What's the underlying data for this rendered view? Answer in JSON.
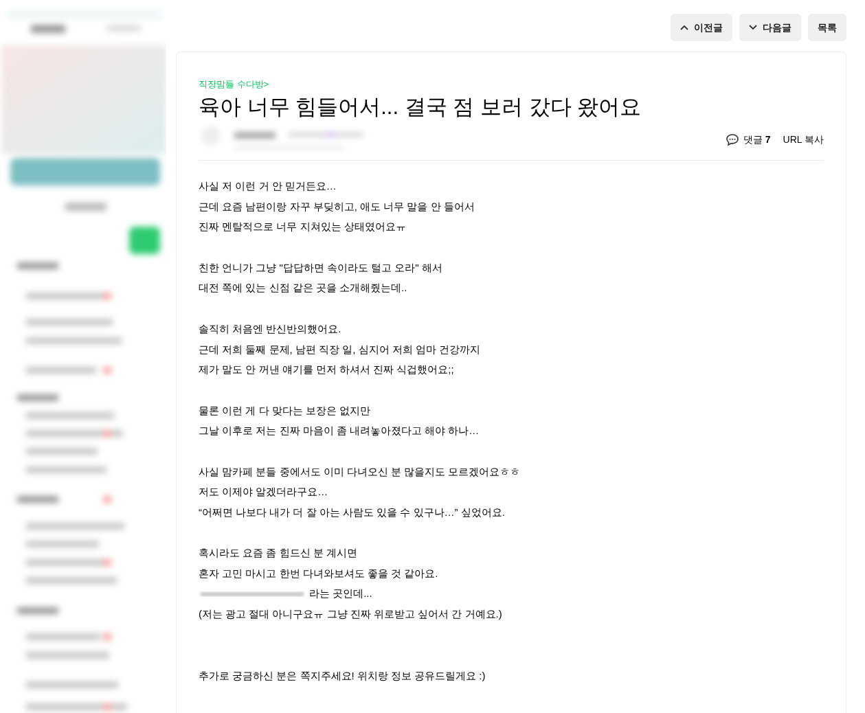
{
  "nav_buttons": [
    {
      "kind": "up",
      "label": "이전글"
    },
    {
      "kind": "down",
      "label": "다음글"
    },
    {
      "kind": "plain",
      "label": "목록"
    }
  ],
  "post": {
    "category": "직장맘들 수다방>",
    "title": "육아 너무 힘들어서... 결국 점 보러 갔다 왔어요",
    "comments_label": "댓글",
    "comments_count": "7",
    "url_copy": "URL 복사",
    "body": [
      {
        "kind": "line",
        "text": "사실 저 이런 거 안 믿거든요…"
      },
      {
        "kind": "line",
        "text": "근데 요즘 남편이랑 자꾸 부딪히고, 애도 너무 말을 안 들어서"
      },
      {
        "kind": "line",
        "text": "진짜 멘탈적으로 너무 지쳐있는 상태였어요ㅠ"
      },
      {
        "kind": "blank"
      },
      {
        "kind": "line",
        "text": "친한 언니가 그냥 \"답답하면 속이라도 털고 오라\" 해서"
      },
      {
        "kind": "line",
        "text": "대전 쪽에 있는 신점 같은 곳을 소개해줬는데.."
      },
      {
        "kind": "blank"
      },
      {
        "kind": "line",
        "text": "솔직히 처음엔 반신반의했어요."
      },
      {
        "kind": "line",
        "text": "근데 저희 둘째 문제, 남편 직장 일, 심지어 저희 엄마 건강까지"
      },
      {
        "kind": "line",
        "text": "제가 말도 안 꺼낸 얘기를 먼저 하셔서 진짜 식겁했어요;;"
      },
      {
        "kind": "blank"
      },
      {
        "kind": "line",
        "text": "물론 이런 게 다 맞다는 보장은 없지만"
      },
      {
        "kind": "line",
        "text": "그날 이후로 저는 진짜 마음이 좀 내려놓아졌다고 해야 하나…"
      },
      {
        "kind": "blank"
      },
      {
        "kind": "line",
        "text": "사실 맘카페 분들 중에서도 이미 다녀오신 분 많을지도 모르겠어요ㅎㅎ"
      },
      {
        "kind": "line",
        "text": "저도 이제야 알겠더라구요…"
      },
      {
        "kind": "line",
        "text": "“어쩌면 나보다 내가 더 잘 아는 사람도 있을 수 있구나…” 싶었어요."
      },
      {
        "kind": "blank"
      },
      {
        "kind": "line",
        "text": "혹시라도 요즘 좀 힘드신 분 계시면"
      },
      {
        "kind": "line",
        "text": "혼자 고민 마시고 한번 다녀와보셔도 좋을 것 같아요."
      },
      {
        "kind": "redacted",
        "text": "라는 곳인데..."
      },
      {
        "kind": "line",
        "text": "(저는 광고 절대 아니구요ㅠ 그냥 진짜 위로받고 싶어서 간 거예요.)"
      },
      {
        "kind": "blank"
      },
      {
        "kind": "blank"
      },
      {
        "kind": "line",
        "text": "추가로 궁금하신 분은 쪽지주세요! 위치랑 정보 공유드릴게요 :)"
      }
    ]
  }
}
